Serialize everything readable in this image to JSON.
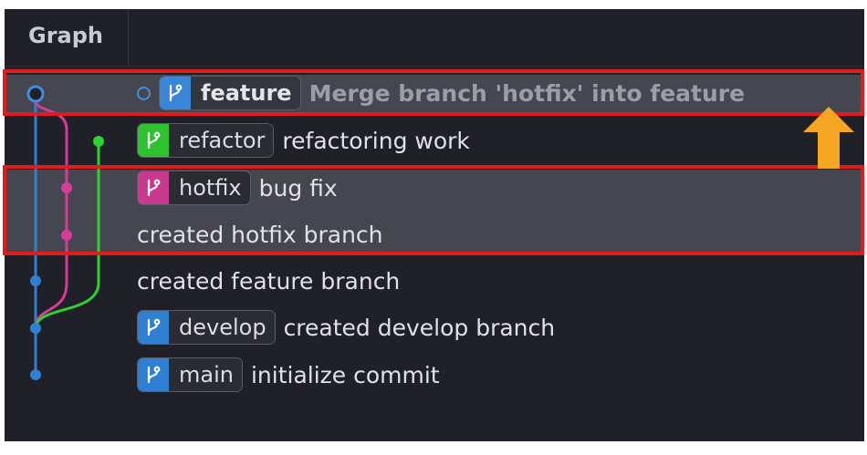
{
  "header": {
    "title": "Graph"
  },
  "colors": {
    "panel_bg": "#1f2028",
    "feature_branch": "#3f8fe0",
    "refactor_branch": "#2fd12f",
    "hotfix_branch": "#d63d98",
    "develop_branch": "#2f7fd4",
    "main_branch": "#2f7fd4",
    "highlight_box": "#e31b1b",
    "arrow": "#f5a623"
  },
  "commits": [
    {
      "branch_label": "feature",
      "branch_icon": "branch-icon",
      "message": "Merge branch 'hotfix' into feature",
      "is_head": true
    },
    {
      "branch_label": "refactor",
      "branch_icon": "branch-icon",
      "message": "refactoring work"
    },
    {
      "branch_label": "hotfix",
      "branch_icon": "branch-icon",
      "message": "bug fix"
    },
    {
      "message": "created hotfix branch"
    },
    {
      "message": "created feature branch"
    },
    {
      "branch_label": "develop",
      "branch_icon": "branch-icon",
      "message": "created develop branch"
    },
    {
      "branch_label": "main",
      "branch_icon": "branch-icon",
      "message": "initialize commit"
    }
  ],
  "annotations": {
    "arrow_icon": "up-arrow-icon",
    "highlight_boxes": 2
  }
}
